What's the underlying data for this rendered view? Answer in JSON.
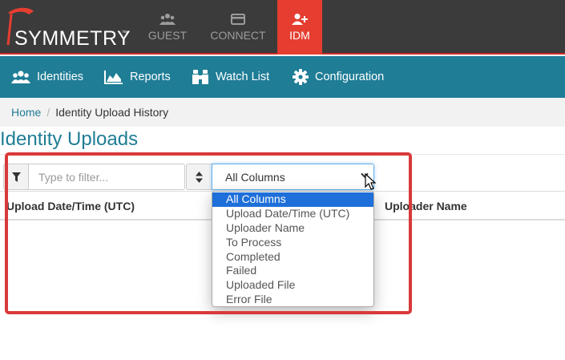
{
  "brand": {
    "logo_text": "SYMMETRY",
    "trademark": "™"
  },
  "top_tabs": {
    "guest": {
      "label": "GUEST",
      "icon": "users-icon"
    },
    "connect": {
      "label": "CONNECT",
      "icon": "card-icon"
    },
    "idm": {
      "label": "IDM",
      "icon": "add-user-icon",
      "active": true
    }
  },
  "nav": {
    "identities": "Identities",
    "reports": "Reports",
    "watch_list": "Watch List",
    "configuration": "Configuration"
  },
  "breadcrumb": {
    "home": "Home",
    "separator": "/",
    "current": "Identity Upload History"
  },
  "page": {
    "title": "Identity Uploads"
  },
  "filter": {
    "placeholder": "Type to filter..."
  },
  "column_select": {
    "selected": "All Columns",
    "options": [
      "All Columns",
      "Upload Date/Time (UTC)",
      "Uploader Name",
      "To Process",
      "Completed",
      "Failed",
      "Uploaded File",
      "Error File"
    ]
  },
  "table": {
    "headers": [
      "Upload Date/Time (UTC)",
      "Uploader Name"
    ]
  },
  "colors": {
    "topbar": "#3b3b3b",
    "idm_active": "#e53e31",
    "nav": "#1f7d96",
    "selection": "#1e6fd9",
    "highlight": "#d9393a"
  }
}
